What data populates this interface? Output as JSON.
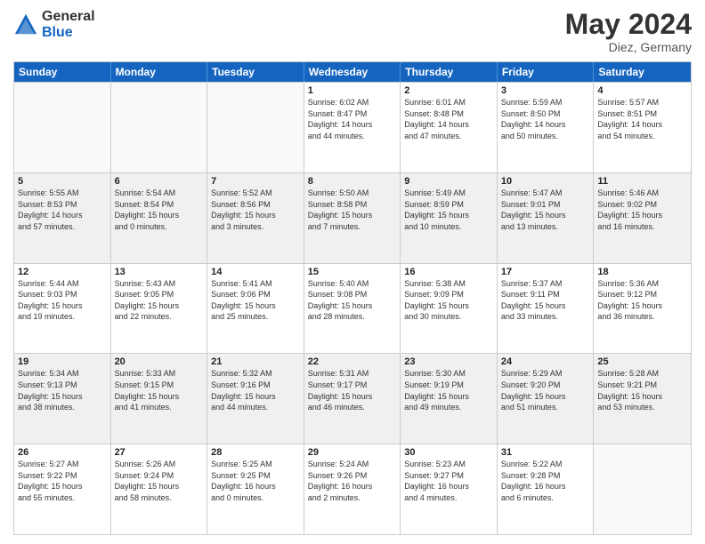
{
  "header": {
    "logo_general": "General",
    "logo_blue": "Blue",
    "title": "May 2024",
    "location": "Diez, Germany"
  },
  "calendar": {
    "days_of_week": [
      "Sunday",
      "Monday",
      "Tuesday",
      "Wednesday",
      "Thursday",
      "Friday",
      "Saturday"
    ],
    "rows": [
      {
        "cells": [
          {
            "day": "",
            "info": ""
          },
          {
            "day": "",
            "info": ""
          },
          {
            "day": "",
            "info": ""
          },
          {
            "day": "1",
            "info": "Sunrise: 6:02 AM\nSunset: 8:47 PM\nDaylight: 14 hours\nand 44 minutes."
          },
          {
            "day": "2",
            "info": "Sunrise: 6:01 AM\nSunset: 8:48 PM\nDaylight: 14 hours\nand 47 minutes."
          },
          {
            "day": "3",
            "info": "Sunrise: 5:59 AM\nSunset: 8:50 PM\nDaylight: 14 hours\nand 50 minutes."
          },
          {
            "day": "4",
            "info": "Sunrise: 5:57 AM\nSunset: 8:51 PM\nDaylight: 14 hours\nand 54 minutes."
          }
        ]
      },
      {
        "cells": [
          {
            "day": "5",
            "info": "Sunrise: 5:55 AM\nSunset: 8:53 PM\nDaylight: 14 hours\nand 57 minutes."
          },
          {
            "day": "6",
            "info": "Sunrise: 5:54 AM\nSunset: 8:54 PM\nDaylight: 15 hours\nand 0 minutes."
          },
          {
            "day": "7",
            "info": "Sunrise: 5:52 AM\nSunset: 8:56 PM\nDaylight: 15 hours\nand 3 minutes."
          },
          {
            "day": "8",
            "info": "Sunrise: 5:50 AM\nSunset: 8:58 PM\nDaylight: 15 hours\nand 7 minutes."
          },
          {
            "day": "9",
            "info": "Sunrise: 5:49 AM\nSunset: 8:59 PM\nDaylight: 15 hours\nand 10 minutes."
          },
          {
            "day": "10",
            "info": "Sunrise: 5:47 AM\nSunset: 9:01 PM\nDaylight: 15 hours\nand 13 minutes."
          },
          {
            "day": "11",
            "info": "Sunrise: 5:46 AM\nSunset: 9:02 PM\nDaylight: 15 hours\nand 16 minutes."
          }
        ]
      },
      {
        "cells": [
          {
            "day": "12",
            "info": "Sunrise: 5:44 AM\nSunset: 9:03 PM\nDaylight: 15 hours\nand 19 minutes."
          },
          {
            "day": "13",
            "info": "Sunrise: 5:43 AM\nSunset: 9:05 PM\nDaylight: 15 hours\nand 22 minutes."
          },
          {
            "day": "14",
            "info": "Sunrise: 5:41 AM\nSunset: 9:06 PM\nDaylight: 15 hours\nand 25 minutes."
          },
          {
            "day": "15",
            "info": "Sunrise: 5:40 AM\nSunset: 9:08 PM\nDaylight: 15 hours\nand 28 minutes."
          },
          {
            "day": "16",
            "info": "Sunrise: 5:38 AM\nSunset: 9:09 PM\nDaylight: 15 hours\nand 30 minutes."
          },
          {
            "day": "17",
            "info": "Sunrise: 5:37 AM\nSunset: 9:11 PM\nDaylight: 15 hours\nand 33 minutes."
          },
          {
            "day": "18",
            "info": "Sunrise: 5:36 AM\nSunset: 9:12 PM\nDaylight: 15 hours\nand 36 minutes."
          }
        ]
      },
      {
        "cells": [
          {
            "day": "19",
            "info": "Sunrise: 5:34 AM\nSunset: 9:13 PM\nDaylight: 15 hours\nand 38 minutes."
          },
          {
            "day": "20",
            "info": "Sunrise: 5:33 AM\nSunset: 9:15 PM\nDaylight: 15 hours\nand 41 minutes."
          },
          {
            "day": "21",
            "info": "Sunrise: 5:32 AM\nSunset: 9:16 PM\nDaylight: 15 hours\nand 44 minutes."
          },
          {
            "day": "22",
            "info": "Sunrise: 5:31 AM\nSunset: 9:17 PM\nDaylight: 15 hours\nand 46 minutes."
          },
          {
            "day": "23",
            "info": "Sunrise: 5:30 AM\nSunset: 9:19 PM\nDaylight: 15 hours\nand 49 minutes."
          },
          {
            "day": "24",
            "info": "Sunrise: 5:29 AM\nSunset: 9:20 PM\nDaylight: 15 hours\nand 51 minutes."
          },
          {
            "day": "25",
            "info": "Sunrise: 5:28 AM\nSunset: 9:21 PM\nDaylight: 15 hours\nand 53 minutes."
          }
        ]
      },
      {
        "cells": [
          {
            "day": "26",
            "info": "Sunrise: 5:27 AM\nSunset: 9:22 PM\nDaylight: 15 hours\nand 55 minutes."
          },
          {
            "day": "27",
            "info": "Sunrise: 5:26 AM\nSunset: 9:24 PM\nDaylight: 15 hours\nand 58 minutes."
          },
          {
            "day": "28",
            "info": "Sunrise: 5:25 AM\nSunset: 9:25 PM\nDaylight: 16 hours\nand 0 minutes."
          },
          {
            "day": "29",
            "info": "Sunrise: 5:24 AM\nSunset: 9:26 PM\nDaylight: 16 hours\nand 2 minutes."
          },
          {
            "day": "30",
            "info": "Sunrise: 5:23 AM\nSunset: 9:27 PM\nDaylight: 16 hours\nand 4 minutes."
          },
          {
            "day": "31",
            "info": "Sunrise: 5:22 AM\nSunset: 9:28 PM\nDaylight: 16 hours\nand 6 minutes."
          },
          {
            "day": "",
            "info": ""
          }
        ]
      }
    ]
  }
}
